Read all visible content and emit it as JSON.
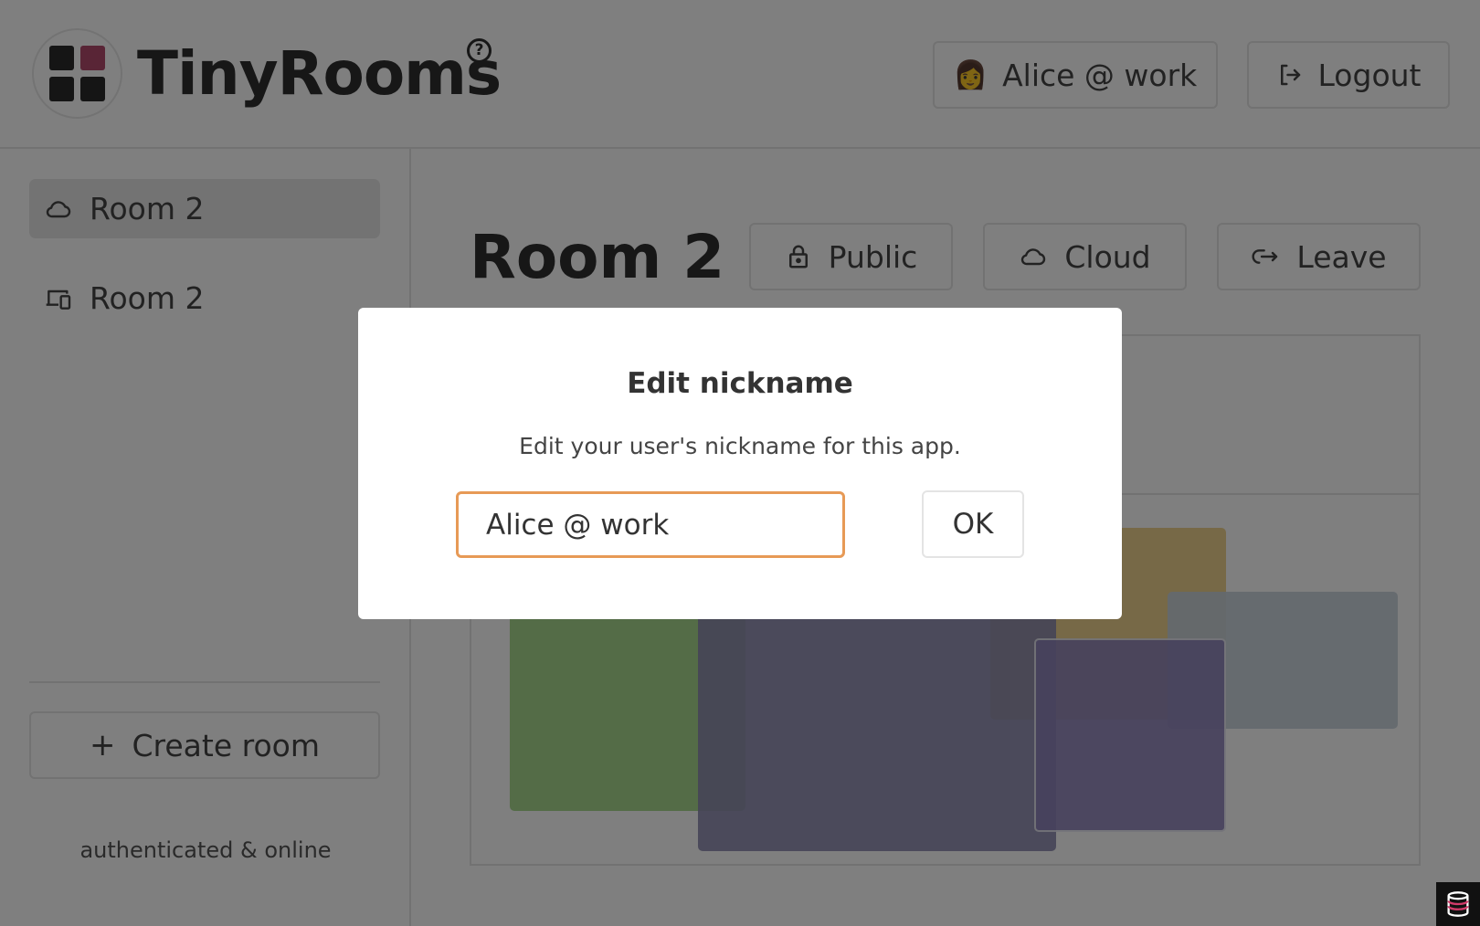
{
  "header": {
    "brand": "TinyRooms",
    "help_icon": "question-circle-icon",
    "user_emoji": "👩",
    "user_label": "Alice @ work",
    "logout_label": "Logout"
  },
  "logo": {
    "colors": [
      "#2a2a2a",
      "#b24a6c",
      "#2a2a2a",
      "#2a2a2a"
    ]
  },
  "sidebar": {
    "items": [
      {
        "label": "Room 2",
        "icon": "cloud-icon",
        "active": true
      },
      {
        "label": "Room 2",
        "icon": "devices-icon",
        "active": false
      }
    ],
    "create_label": "Create room",
    "create_icon": "+",
    "status": "authenticated & online"
  },
  "main": {
    "room_title": "Room 2",
    "buttons": [
      {
        "label": "Public",
        "icon": "lock-icon"
      },
      {
        "label": "Cloud",
        "icon": "cloud-icon"
      },
      {
        "label": "Leave",
        "icon": "leave-icon"
      }
    ]
  },
  "canvas": {
    "shape_colors": {
      "green": "#a8d88f",
      "navy": "#8b89ae",
      "gold": "#efd28f",
      "slate": "#c8d2dc",
      "purple": "#8e83bb"
    }
  },
  "modal": {
    "title": "Edit nickname",
    "description": "Edit your user's nickname for this app.",
    "input_value": "Alice @ work",
    "ok_label": "OK",
    "input_focus_color": "#e79a56"
  }
}
